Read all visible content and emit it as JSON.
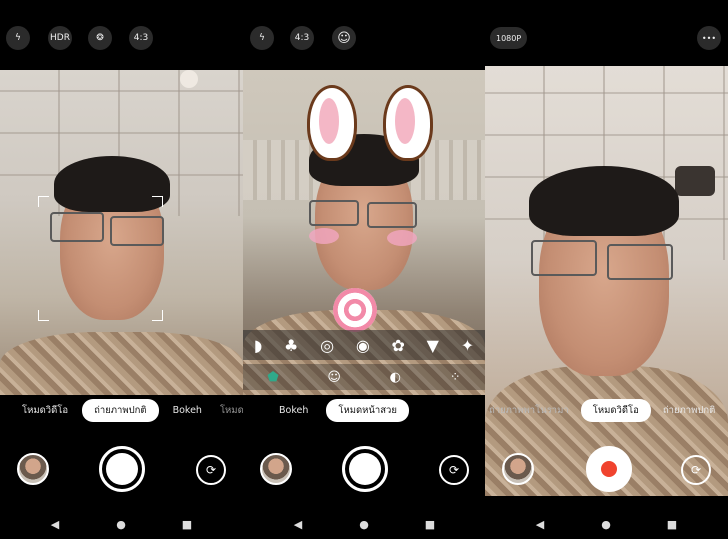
{
  "panel_left": {
    "top_icons": [
      "flash-off-icon",
      "HDR",
      "filter-icon",
      "4:3"
    ],
    "modes": [
      "โหมดวิดีโอ",
      "ถ่ายภาพปกติ",
      "Bokeh",
      "โหมดบิ"
    ],
    "active_mode": "ถ่ายภาพปกติ"
  },
  "panel_middle": {
    "top_icons": [
      "more-icon",
      "flash-off-icon",
      "4:3",
      "face-beauty-icon"
    ],
    "modes": [
      "Bokeh",
      "โหมดหน้าสวย"
    ],
    "active_mode": "โหมดหน้าสวย",
    "sticker_row": [
      "slippers-icon",
      "pineapple-icon",
      "lollipop-icon",
      "cat-icon",
      "flower-icon",
      "carrot-icon",
      "sparkle-icon"
    ],
    "effect_icons": [
      "mask-icon",
      "beauty-face-icon",
      "contrast-icon",
      "grid-dots-icon"
    ]
  },
  "panel_right": {
    "top_icons": [
      "more-icon",
      "1080P",
      "more-icon"
    ],
    "modes": [
      "ถ่ายภาพพาโนรามา",
      "โหมดวิดีโอ",
      "ถ่ายภาพปกติ"
    ],
    "active_mode": "โหมดวิดีโอ"
  },
  "nav": {
    "back": "◀",
    "home": "●",
    "recents": "■"
  },
  "glyphs": {
    "more": "•••",
    "flash_off": "ϟ̸",
    "switch_camera": "⟳"
  }
}
